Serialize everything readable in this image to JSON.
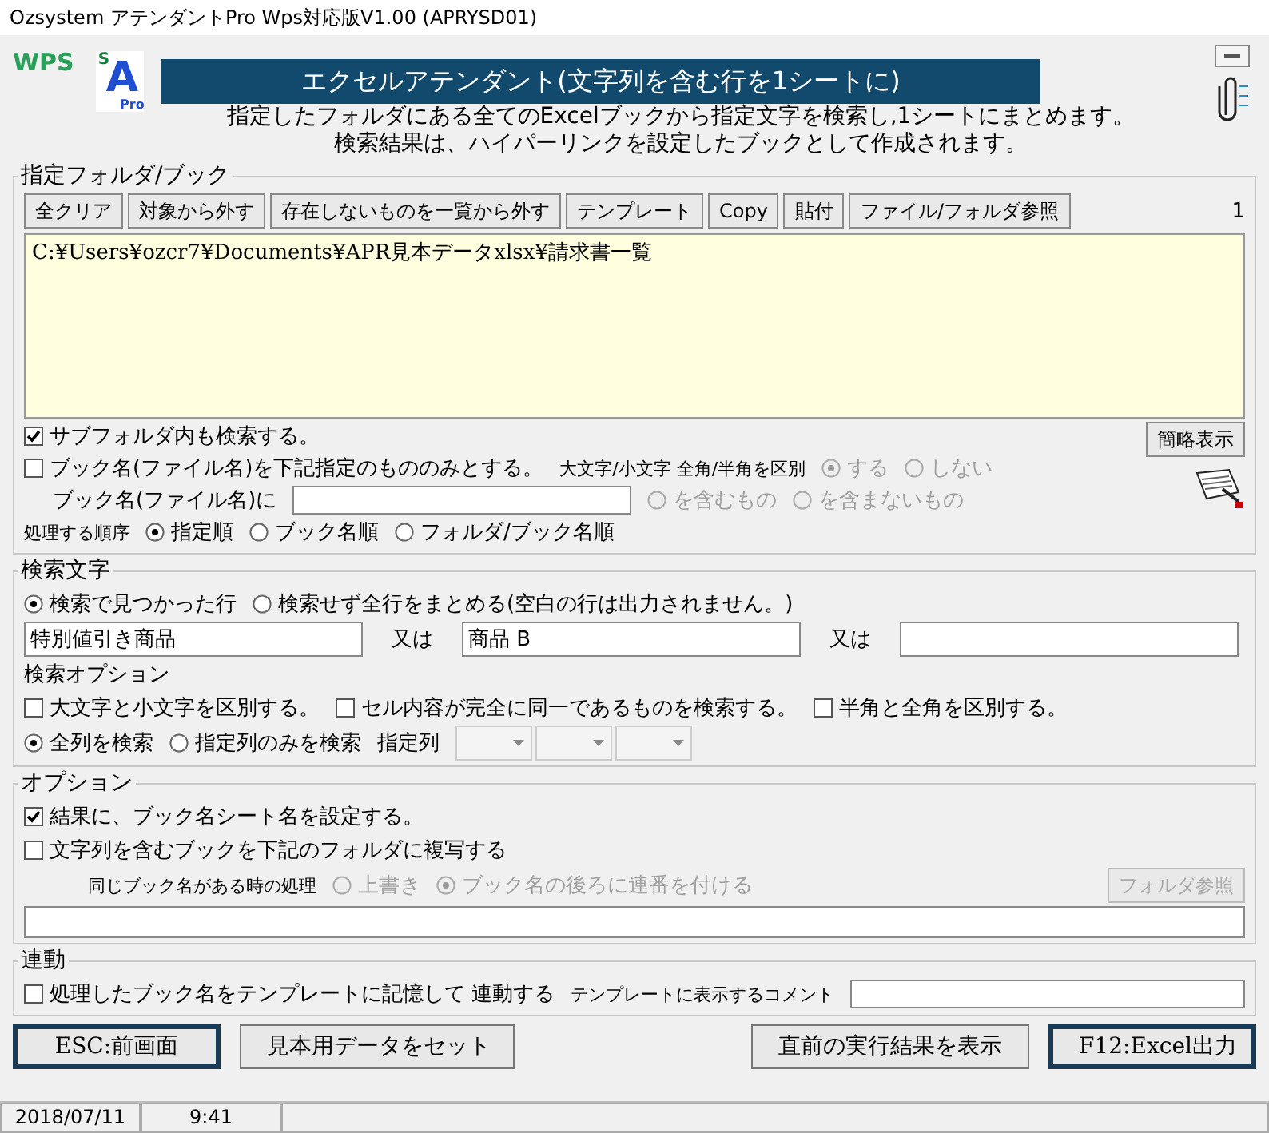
{
  "window": {
    "title": "Ozsystem アテンダントPro Wps対応版V1.00 (APRYSD01)"
  },
  "header": {
    "wps_logo": "WPS",
    "app_logo": {
      "top": "S",
      "main": "A",
      "sub": "Pro"
    },
    "banner": "エクセルアテンダント(文字列を含む行を1シートに)",
    "description": [
      "指定したフォルダにある全てのExcelブックから指定文字を検索し,1シートにまとめます。",
      "検索結果は、ハイパーリンクを設定したブックとして作成されます。"
    ]
  },
  "folder_section": {
    "legend": "指定フォルダ/ブック",
    "buttons": [
      "全クリア",
      "対象から外す",
      "存在しないものを一覧から外す",
      "テンプレート",
      "Copy",
      "貼付",
      "ファイル/フォルダ参照"
    ],
    "count": "1",
    "paths": [
      "C:¥Users¥ozcr7¥Documents¥APR見本データxlsx¥請求書一覧"
    ],
    "subfolder": {
      "label": "サブフォルダ内も検索する。",
      "checked": true
    },
    "book_filter": {
      "label": "ブック名(ファイル名)を下記指定のもののみとする。",
      "checked": false
    },
    "case_label": "大文字/小文字 全角/半角を区別",
    "case_options": [
      {
        "label": "する",
        "selected": true,
        "disabled": true
      },
      {
        "label": "しない",
        "selected": false,
        "disabled": true
      }
    ],
    "brief_button": "簡略表示",
    "book_name_label": "ブック名(ファイル名)に",
    "match_options": [
      {
        "label": "を含むもの",
        "selected": false,
        "disabled": true
      },
      {
        "label": "を含まないもの",
        "selected": false,
        "disabled": true
      }
    ],
    "order_label": "処理する順序",
    "order_options": [
      {
        "label": "指定順",
        "selected": true
      },
      {
        "label": "ブック名順",
        "selected": false
      },
      {
        "label": "フォルダ/ブック名順",
        "selected": false
      }
    ]
  },
  "search_section": {
    "legend": "検索文字",
    "mode_options": [
      {
        "label": "検索で見つかった行",
        "selected": true
      },
      {
        "label": "検索せず全行をまとめる(空白の行は出力されません。)",
        "selected": false
      }
    ],
    "terms": [
      {
        "value": "特別値引き商品"
      },
      {
        "label": "又は",
        "value": "商品 B"
      },
      {
        "label": "又は"
      }
    ],
    "options_label": "検索オプション",
    "checks": [
      {
        "label": "大文字と小文字を区別する。",
        "checked": false
      },
      {
        "label": "セル内容が完全に同一であるものを検索する。",
        "checked": false
      },
      {
        "label": "半角と全角を区別する。",
        "checked": false
      }
    ],
    "column_options": [
      {
        "label": "全列を検索",
        "selected": true
      },
      {
        "label": "指定列のみを検索",
        "selected": false
      }
    ],
    "column_label": "指定列",
    "column_selects": [
      {
        "disabled": true
      },
      {
        "disabled": true
      },
      {
        "disabled": true
      }
    ]
  },
  "options_section": {
    "legend": "オプション",
    "checks": [
      {
        "label": "結果に、ブック名シート名を設定する。",
        "checked": true
      },
      {
        "label": "文字列を含むブックを下記のフォルダに複写する",
        "checked": false
      }
    ],
    "duplicate_label": "同じブック名がある時の処理",
    "duplicate_options": [
      {
        "label": "上書き",
        "selected": false,
        "disabled": true
      },
      {
        "label": "ブック名の後ろに連番を付ける",
        "selected": true,
        "disabled": true
      }
    ],
    "folder_button": {
      "label": "フォルダ参照",
      "disabled": true
    }
  },
  "link_section": {
    "legend": "連動",
    "check": {
      "label": "処理したブック名をテンプレートに記憶して 連動する",
      "checked": false
    },
    "comment_label": "テンプレートに表示するコメント"
  },
  "footer_buttons": [
    {
      "label": "ESC:前画面",
      "default": true
    },
    {
      "label": "見本用データをセット",
      "default": false
    },
    {
      "label": "直前の実行結果を表示",
      "default": false
    },
    {
      "label": "F12:Excel出力",
      "default": true
    }
  ],
  "status_bar": [
    "2018/07/11",
    "9:41"
  ]
}
